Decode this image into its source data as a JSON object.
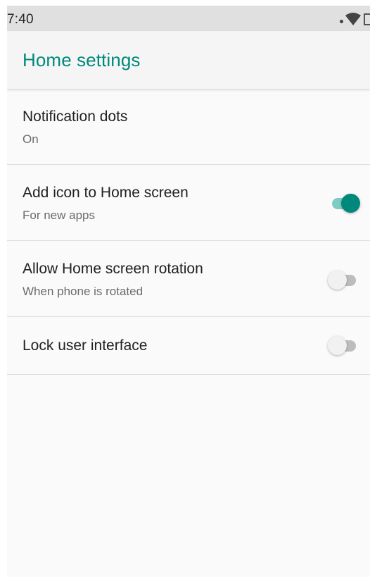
{
  "status_bar": {
    "time": "7:40",
    "icons": [
      "signal-icon",
      "wifi-icon",
      "battery-icon"
    ]
  },
  "header": {
    "title": "Home settings"
  },
  "settings": [
    {
      "title": "Notification dots",
      "summary": "On"
    },
    {
      "title": "Add icon to Home screen",
      "summary": "For new apps",
      "toggle": "on"
    },
    {
      "title": "Allow Home screen rotation",
      "summary": "When phone is rotated",
      "toggle": "off"
    },
    {
      "title": "Lock user interface",
      "toggle": "off"
    }
  ],
  "colors": {
    "accent": "#00897b",
    "accent_light": "#80cbc4",
    "switch_off_track": "#bdbdbd",
    "switch_off_thumb": "#f1f1f1",
    "background": "#fafafa",
    "status_bar": "#e0e0e0"
  }
}
